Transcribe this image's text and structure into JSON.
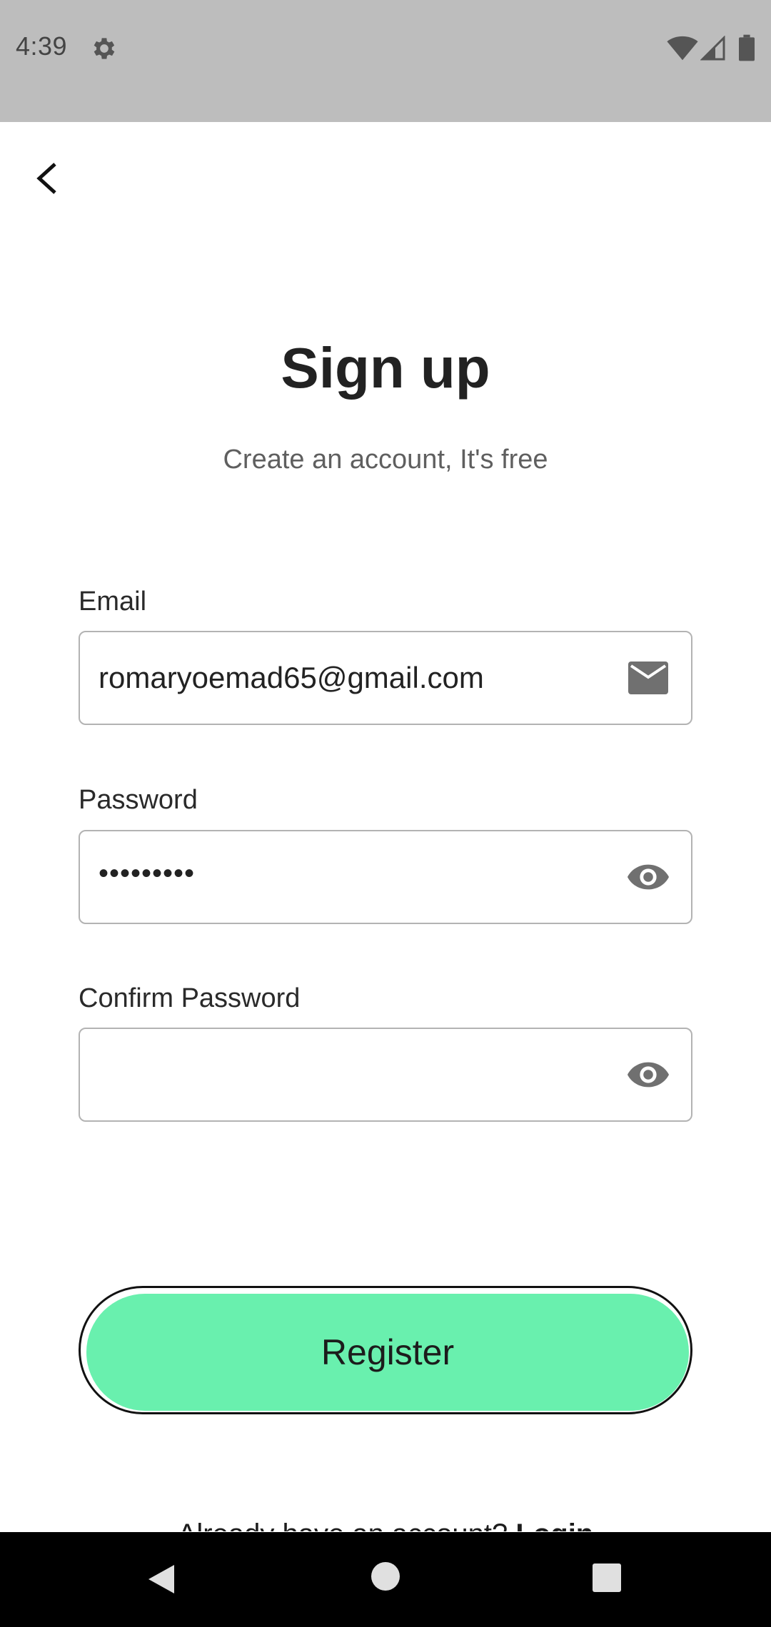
{
  "status_bar": {
    "time": "4:39",
    "icons": [
      "settings-gear-icon",
      "wifi-icon",
      "cell-signal-icon",
      "battery-icon"
    ]
  },
  "header": {
    "back_icon": "chevron-left-icon"
  },
  "title": "Sign up",
  "subtitle": "Create an account, It's free",
  "form": {
    "email": {
      "label": "Email",
      "value": "romaryoemad65@gmail.com",
      "icon": "mail-icon"
    },
    "password": {
      "label": "Password",
      "value": "•••••••••",
      "icon": "eye-icon"
    },
    "confirm_password": {
      "label": "Confirm Password",
      "value": "",
      "icon": "eye-icon"
    }
  },
  "register_button": {
    "label": "Register"
  },
  "footer": {
    "text": "Already have an account? ",
    "link": "Login"
  },
  "colors": {
    "status_bar": "#bdbdbd",
    "button_fill": "#69f0ae",
    "field_border": "#b3b3b3",
    "nav_bar": "#000000"
  }
}
